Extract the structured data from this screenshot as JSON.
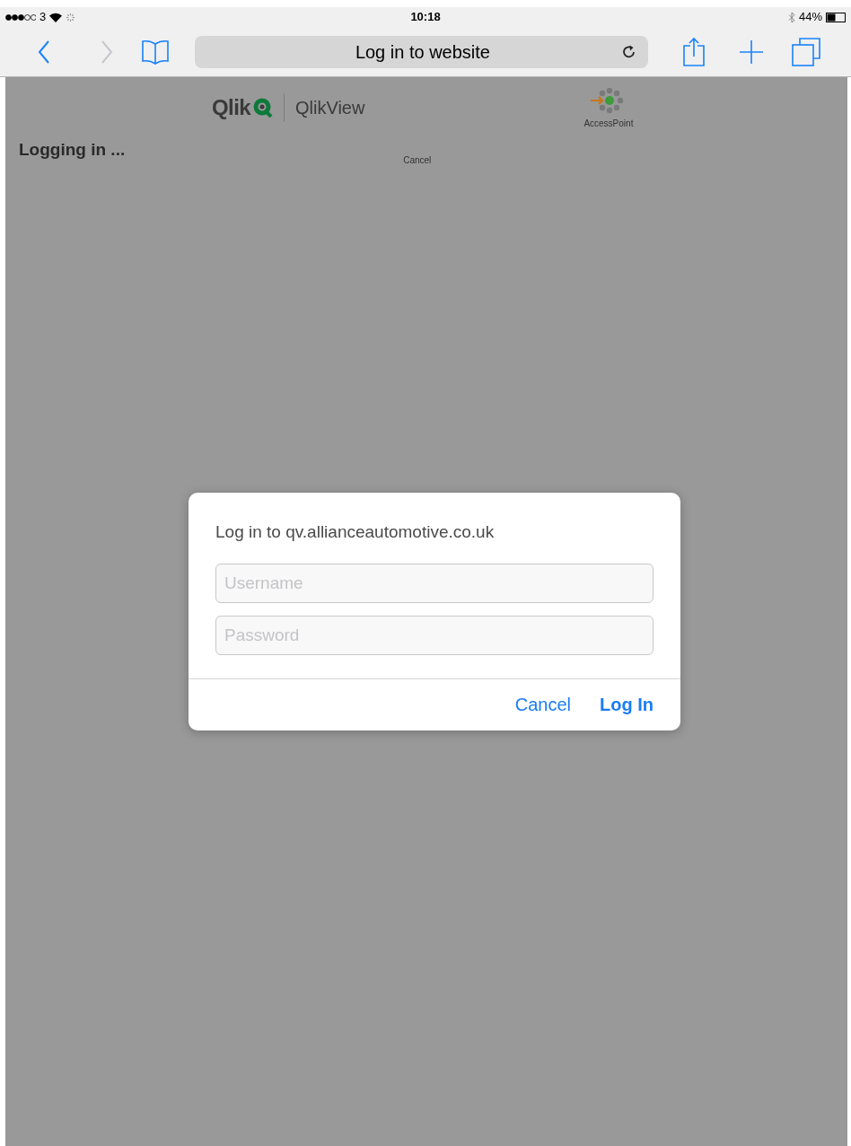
{
  "status_bar": {
    "carrier": "3",
    "time": "10:18",
    "battery": "44%"
  },
  "toolbar": {
    "back": {
      "disabled": false
    },
    "forward": {
      "disabled": true
    },
    "address": "Log in to website"
  },
  "page": {
    "brand": "Qlik",
    "product": "QlikView",
    "access_point": "AccessPoint",
    "heading": "Logging in ...",
    "cancel_link": "Cancel"
  },
  "dialog": {
    "title": "Log in to qv.allianceautomotive.co.uk",
    "fields": [
      {
        "placeholder": "Username"
      },
      {
        "placeholder": "Password"
      }
    ],
    "buttons": [
      {
        "label": "Cancel",
        "kind": "secondary"
      },
      {
        "label": "Log In",
        "kind": "primary"
      }
    ]
  }
}
